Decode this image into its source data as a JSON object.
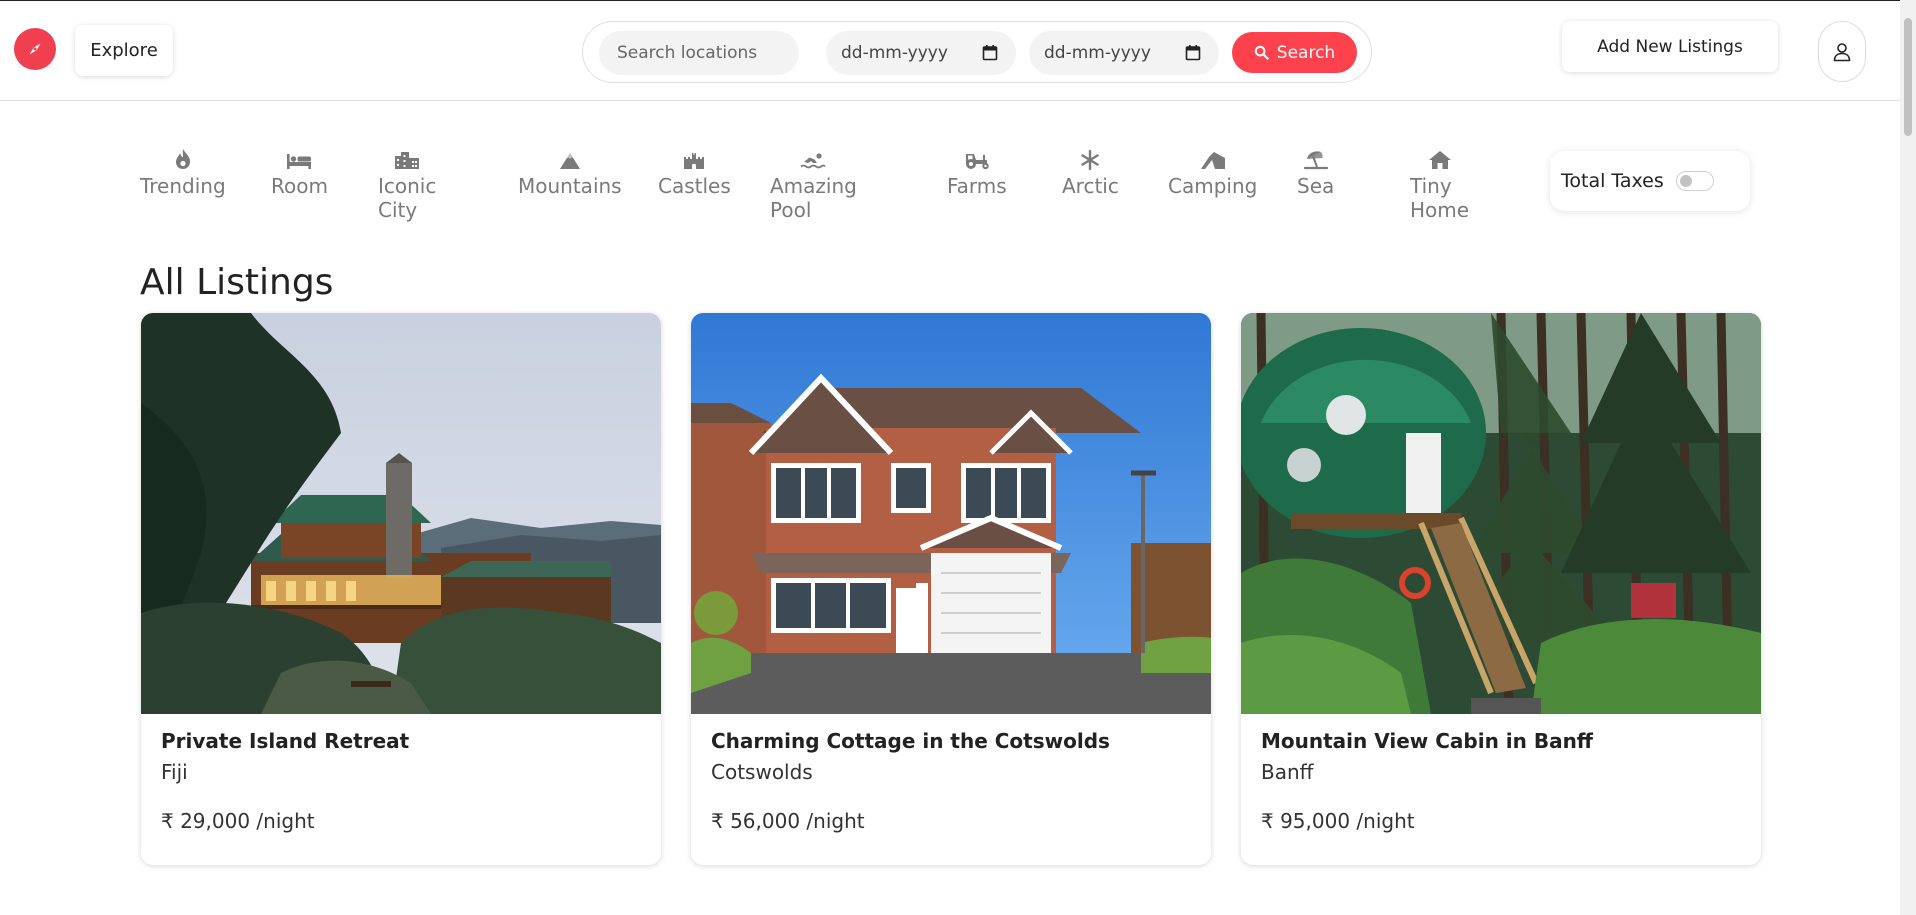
{
  "header": {
    "logo_icon": "compass-icon",
    "brand_color": "#fe424d",
    "explore_label": "Explore",
    "search": {
      "location_placeholder": "Search locations",
      "checkin_placeholder": "dd-mm-yyyy",
      "checkout_placeholder": "dd-mm-yyyy",
      "button_label": "Search"
    },
    "add_listing_label": "Add New Listings",
    "user_icon": "user-icon"
  },
  "filters": [
    {
      "label": "Trending",
      "icon": "fire-icon"
    },
    {
      "label": "Room",
      "icon": "bed-icon"
    },
    {
      "label": "Iconic City",
      "icon": "city-icon"
    },
    {
      "label": "Mountains",
      "icon": "mountain-icon"
    },
    {
      "label": "Castles",
      "icon": "castle-icon"
    },
    {
      "label": "Amazing Pool",
      "icon": "swimmer-icon"
    },
    {
      "label": "Farms",
      "icon": "tractor-icon"
    },
    {
      "label": "Arctic",
      "icon": "snowflake-icon"
    },
    {
      "label": "Camping",
      "icon": "tent-icon"
    },
    {
      "label": "Sea",
      "icon": "umbrella-beach-icon"
    },
    {
      "label": "Tiny Home",
      "icon": "house-icon"
    }
  ],
  "taxes_toggle": {
    "label": "Total Taxes",
    "on": false
  },
  "listings": {
    "heading": "All Listings",
    "items": [
      {
        "title": "Private Island Retreat",
        "location": "Fiji",
        "price": "₹ 29,000 /night",
        "image": "wooden lodge lit at dusk surrounded by trees"
      },
      {
        "title": "Charming Cottage in the Cotswolds",
        "location": "Cotswolds",
        "price": "₹ 56,000 /night",
        "image": "red brick detached house with garage under blue sky"
      },
      {
        "title": "Mountain View Cabin in Banff",
        "location": "Banff",
        "price": "₹ 95,000 /night",
        "image": "green dome treehouse in a pine forest"
      }
    ]
  }
}
